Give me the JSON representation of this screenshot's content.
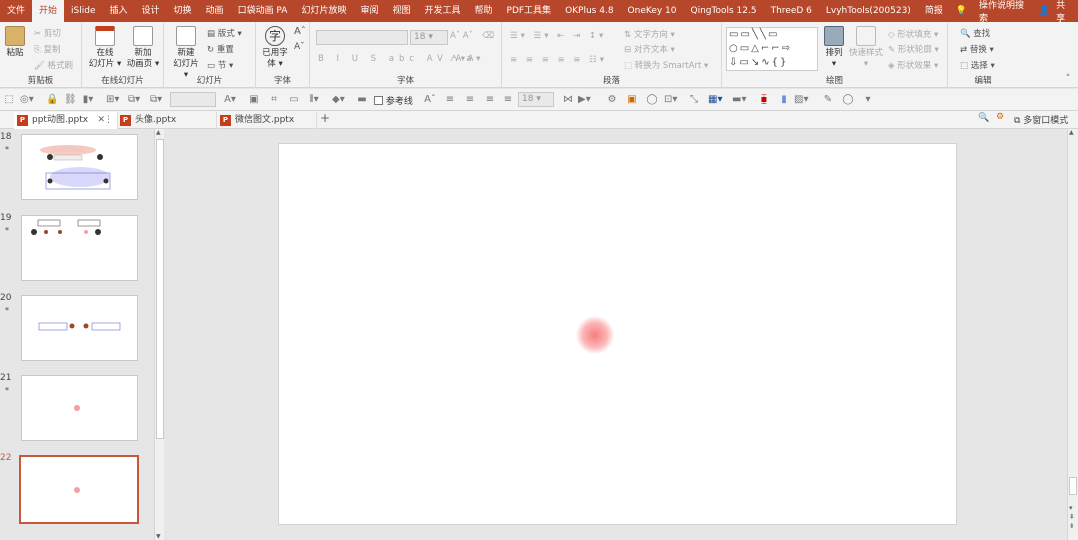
{
  "menu_tabs": [
    "文件",
    "开始",
    "iSlide",
    "插入",
    "设计",
    "切换",
    "动画",
    "口袋动画 PA",
    "幻灯片放映",
    "审阅",
    "视图",
    "开发工具",
    "帮助",
    "PDF工具集",
    "OKPlus 4.8",
    "OneKey 10",
    "QingTools 12.5",
    "ThreeD 6",
    "LvyhTools(200523)",
    "简报"
  ],
  "active_tab": "开始",
  "tell_me": "操作说明搜索",
  "share": "共享",
  "ribbon": {
    "clipboard": {
      "paste": "粘贴",
      "cut": "剪切",
      "copy": "复制",
      "format_painter": "格式刷",
      "label": "剪贴板"
    },
    "online_slides": {
      "online": "在线",
      "online2": "幻灯片",
      "new_anim": "新加",
      "new_anim2": "动画页",
      "label": "在线幻灯片"
    },
    "slides": {
      "new": "新建",
      "new2": "幻灯片",
      "layout": "版式",
      "reset": "重置",
      "section": "节",
      "label": "幻灯片"
    },
    "font_group": {
      "used_font": "已用字",
      "used_font2": "体",
      "label": "字体"
    },
    "font": {
      "size": "18",
      "label": "字体"
    },
    "paragraph": {
      "text_direction": "文字方向",
      "align_text": "对齐文本",
      "smartart": "转换为 SmartArt",
      "label": "段落"
    },
    "drawing": {
      "arrange": "排列",
      "quick_styles": "快速样式",
      "shape_fill": "形状填充",
      "shape_outline": "形状轮廓",
      "shape_effects": "形状效果",
      "label": "绘图"
    },
    "editing": {
      "find": "查找",
      "replace": "替换",
      "select": "选择",
      "label": "编辑"
    }
  },
  "qat": {
    "gridlines": "参考线",
    "font_size": "18"
  },
  "doc_tabs": [
    {
      "name": "ppt动图.pptx",
      "active": true
    },
    {
      "name": "头像.pptx",
      "active": false
    },
    {
      "name": "微信图文.pptx",
      "active": false
    }
  ],
  "multi_window": "多窗口模式",
  "slides": [
    {
      "number": "18",
      "star": "*"
    },
    {
      "number": "19",
      "star": "*"
    },
    {
      "number": "20",
      "star": "*"
    },
    {
      "number": "21",
      "star": "*"
    },
    {
      "number": "22",
      "star": ""
    }
  ],
  "colors": {
    "accent": "#b7472a",
    "selected_border": "#c55a3a",
    "dot": "#f58080"
  }
}
